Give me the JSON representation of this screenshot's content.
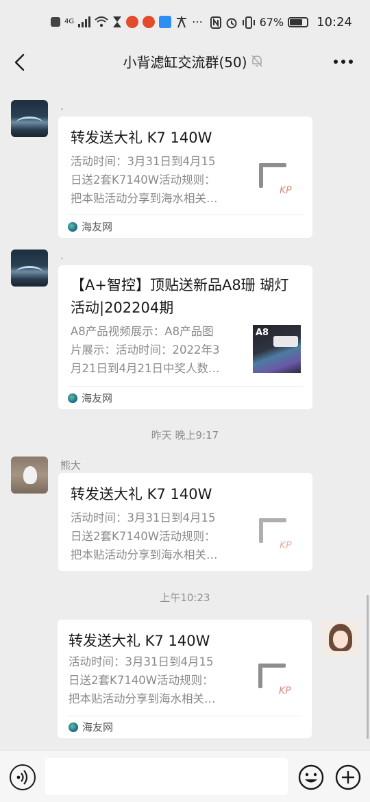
{
  "status_bar": {
    "network": "4G",
    "battery_percent": "67%",
    "time": "10:24"
  },
  "header": {
    "title": "小背滤缸交流群(50)"
  },
  "messages": [
    {
      "sender": ".",
      "card": {
        "title": "转发送大礼 K7 140W",
        "desc_lines": [
          "活动时间：3月31日到4月15",
          "日送2套K7140W活动规则：",
          "把本贴活动分享到海水相关…"
        ],
        "source": "海友网"
      }
    },
    {
      "sender": ".",
      "card": {
        "title_lines": [
          "【A+智控】顶贴送新品A8珊 瑚灯",
          "活动|202204期"
        ],
        "desc_lines": [
          "A8产品视频展示：A8产品图",
          "片展示：活动时间：2022年3",
          "月21日到4月21日中奖人数…"
        ],
        "thumb_text": "A8",
        "source": "海友网"
      }
    },
    {
      "timestamp": "昨天 晚上9:17"
    },
    {
      "sender": "熊大",
      "card": {
        "title": "转发送大礼 K7 140W",
        "desc_lines": [
          "活动时间：3月31日到4月15",
          "日送2套K7140W活动规则：",
          "把本贴活动分享到海水相关…"
        ]
      }
    },
    {
      "timestamp": "上午10:23"
    },
    {
      "card": {
        "title": "转发送大礼 K7 140W",
        "desc_lines": [
          "活动时间：3月31日到4月15",
          "日送2套K7140W活动规则：",
          "把本贴活动分享到海水相关…"
        ],
        "source": "海友网"
      }
    }
  ],
  "thumb_logo": "KP",
  "input": {
    "value": ""
  }
}
